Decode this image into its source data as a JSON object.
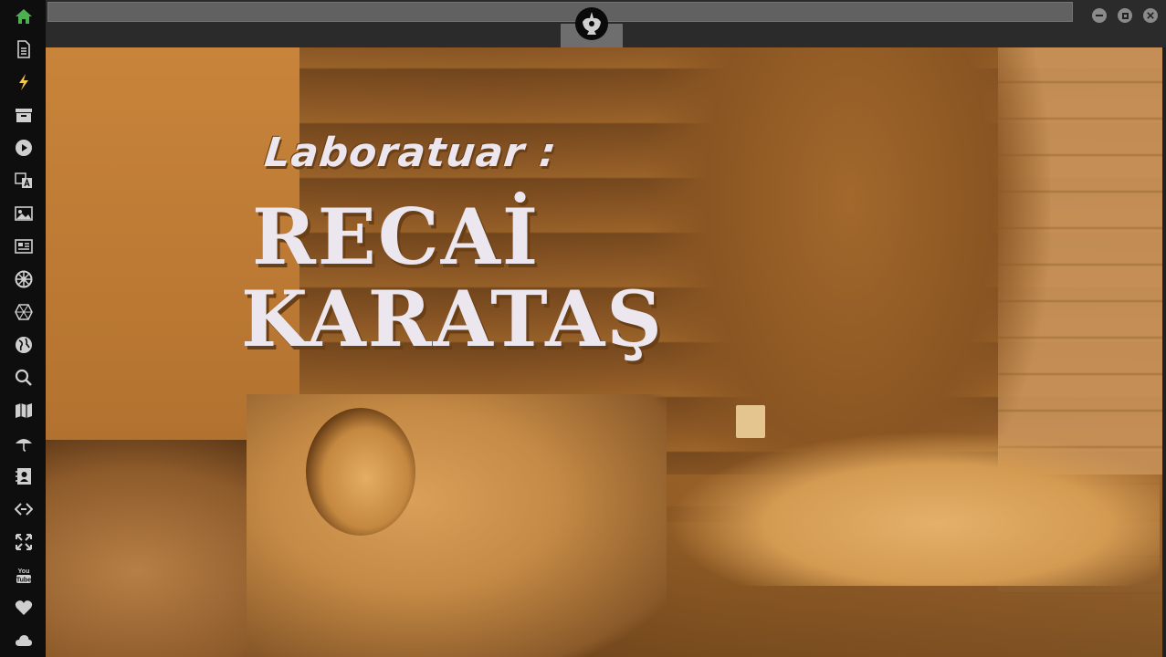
{
  "sidebar": {
    "items": [
      {
        "icon": "home-icon",
        "color": "#4caf50"
      },
      {
        "icon": "document-icon",
        "color": "#cfcfcf"
      },
      {
        "icon": "lightning-icon",
        "color": "#f2c94c"
      },
      {
        "icon": "archive-icon",
        "color": "#cfcfcf"
      },
      {
        "icon": "play-icon",
        "color": "#cfcfcf"
      },
      {
        "icon": "translate-icon",
        "color": "#cfcfcf"
      },
      {
        "icon": "image-icon",
        "color": "#cfcfcf"
      },
      {
        "icon": "newspaper-icon",
        "color": "#cfcfcf"
      },
      {
        "icon": "empire-icon",
        "color": "#cfcfcf"
      },
      {
        "icon": "hexagon-icon",
        "color": "#cfcfcf"
      },
      {
        "icon": "globe-icon",
        "color": "#cfcfcf"
      },
      {
        "icon": "search-icon",
        "color": "#cfcfcf"
      },
      {
        "icon": "map-icon",
        "color": "#cfcfcf"
      },
      {
        "icon": "umbrella-icon",
        "color": "#cfcfcf"
      },
      {
        "icon": "contacts-icon",
        "color": "#cfcfcf"
      },
      {
        "icon": "code-icon",
        "color": "#cfcfcf"
      },
      {
        "icon": "fullscreen-icon",
        "color": "#cfcfcf"
      },
      {
        "icon": "youtube-icon",
        "color": "#cfcfcf"
      },
      {
        "icon": "heart-icon",
        "color": "#cfcfcf"
      },
      {
        "icon": "cloud-icon",
        "color": "#cfcfcf"
      }
    ]
  },
  "topbar": {
    "url_value": "",
    "center_icon": "rebel-alliance-icon",
    "window_buttons": [
      "minimize-icon",
      "maximize-icon",
      "close-icon"
    ]
  },
  "video": {
    "title_line1": "Laboratuar :",
    "title_line2": "RECAİ",
    "title_line3": "KARATAŞ"
  }
}
